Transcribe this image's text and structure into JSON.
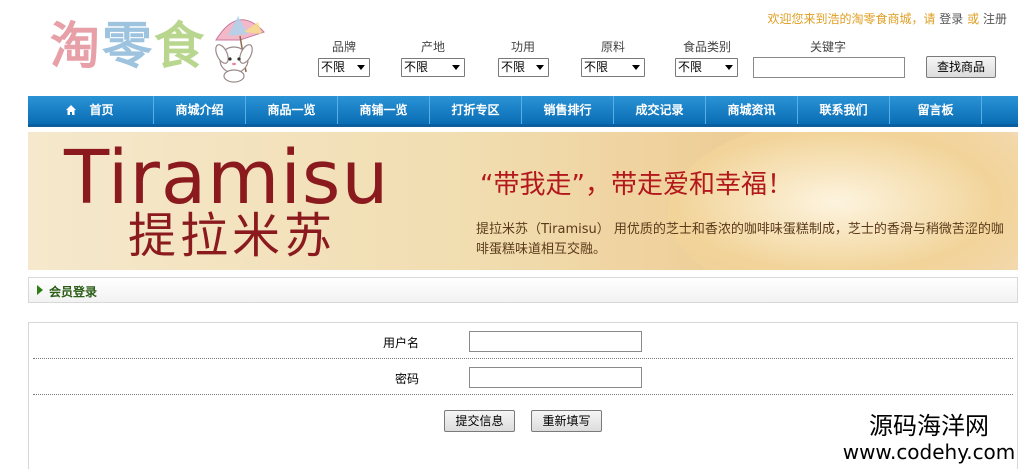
{
  "logo": {
    "chars": [
      "淘",
      "零",
      "食"
    ]
  },
  "welcome": {
    "text": "欢迎您来到浩的淘零食商城，请",
    "login": "登录",
    "or": "或",
    "register": "注册"
  },
  "filters": [
    {
      "label": "品牌",
      "value": "不限"
    },
    {
      "label": "产地",
      "value": "不限"
    },
    {
      "label": "功用",
      "value": "不限"
    },
    {
      "label": "原料",
      "value": "不限"
    },
    {
      "label": "食品类别",
      "value": "不限"
    }
  ],
  "keyword": {
    "label": "关键字",
    "value": ""
  },
  "search_button": "查找商品",
  "nav": [
    "首页",
    "商城介绍",
    "商品一览",
    "商铺一览",
    "打折专区",
    "销售排行",
    "成交记录",
    "商城资讯",
    "联系我们",
    "留言板"
  ],
  "banner": {
    "title_en": "Tiramisu",
    "title_cn": "提拉米苏",
    "slogan": "“带我走”，带走爱和幸福！",
    "desc": "提拉米苏（Tiramisu） 用优质的芝士和香浓的咖啡味蛋糕制成，芝士的香滑与稍微苦涩的咖啡蛋糕味道相互交融。"
  },
  "login_section": {
    "title": "会员登录"
  },
  "form": {
    "username_label": "用户名",
    "username_value": "",
    "password_label": "密码",
    "password_value": "",
    "submit": "提交信息",
    "reset": "重新填写"
  },
  "watermark": {
    "cn": "源码海洋网",
    "url": "www.codehy.com"
  },
  "colors": {
    "nav_blue": "#1a80c6",
    "banner_red": "#8b1a1f",
    "welcome_orange": "#e09e22",
    "section_green": "#2b5d17"
  }
}
